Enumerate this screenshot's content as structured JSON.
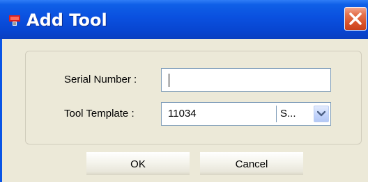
{
  "window": {
    "title": "Add Tool",
    "accent_color": "#0a50df",
    "close_color": "#d9532a"
  },
  "icons": {
    "app": "tool-icon",
    "close": "close-icon",
    "dropdown": "chevron-down-icon"
  },
  "form": {
    "serial_label": "Serial Number :",
    "serial_value": "",
    "template_label": "Tool Template :",
    "template_value": "11034",
    "template_secondary": "S..."
  },
  "buttons": {
    "ok_label": "OK",
    "cancel_label": "Cancel"
  }
}
